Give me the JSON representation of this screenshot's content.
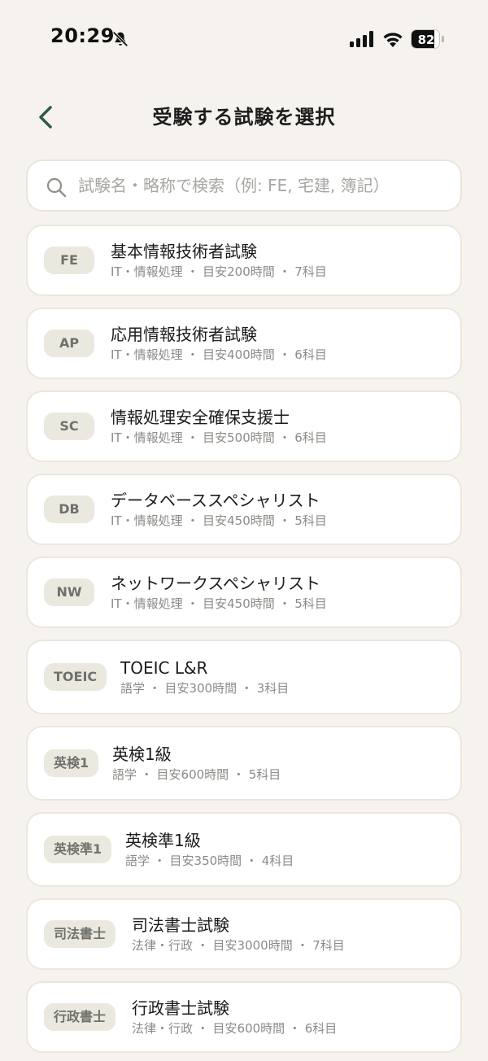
{
  "status_bar": {
    "time": "20:29",
    "battery": "82",
    "battery_level": 0.82,
    "icons": [
      "bell-slash-icon",
      "signal-icon",
      "wifi-icon",
      "battery-icon"
    ]
  },
  "header": {
    "title": "受験する試験を選択",
    "back_icon": "chevron-left-icon"
  },
  "search": {
    "placeholder": "試験名・略称で検索（例: FE, 宅建, 簿記）",
    "value": ""
  },
  "exams": [
    {
      "badge": "FE",
      "name": "基本情報技術者試験",
      "meta": "IT・情報処理 ・ 目安200時間 ・ 7科目"
    },
    {
      "badge": "AP",
      "name": "応用情報技術者試験",
      "meta": "IT・情報処理 ・ 目安400時間 ・ 6科目"
    },
    {
      "badge": "SC",
      "name": "情報処理安全確保支援士",
      "meta": "IT・情報処理 ・ 目安500時間 ・ 6科目"
    },
    {
      "badge": "DB",
      "name": "データベーススペシャリスト",
      "meta": "IT・情報処理 ・ 目安450時間 ・ 5科目"
    },
    {
      "badge": "NW",
      "name": "ネットワークスペシャリスト",
      "meta": "IT・情報処理 ・ 目安450時間 ・ 5科目"
    },
    {
      "badge": "TOEIC",
      "name": "TOEIC L&R",
      "meta": "語学 ・ 目安300時間 ・ 3科目"
    },
    {
      "badge": "英検1",
      "name": "英検1級",
      "meta": "語学 ・ 目安600時間 ・ 5科目"
    },
    {
      "badge": "英検準1",
      "name": "英検準1級",
      "meta": "語学 ・ 目安350時間 ・ 4科目"
    },
    {
      "badge": "司法書士",
      "name": "司法書士試験",
      "meta": "法律・行政 ・ 目安3000時間 ・ 7科目"
    },
    {
      "badge": "行政書士",
      "name": "行政書士試験",
      "meta": "法律・行政 ・ 目安600時間 ・ 6科目"
    }
  ],
  "colors": {
    "background": "#f6f3ee",
    "card": "#ffffff",
    "badge_bg": "#ebe8e0",
    "badge_text": "#6f716c",
    "accent": "#2f5a4b"
  }
}
